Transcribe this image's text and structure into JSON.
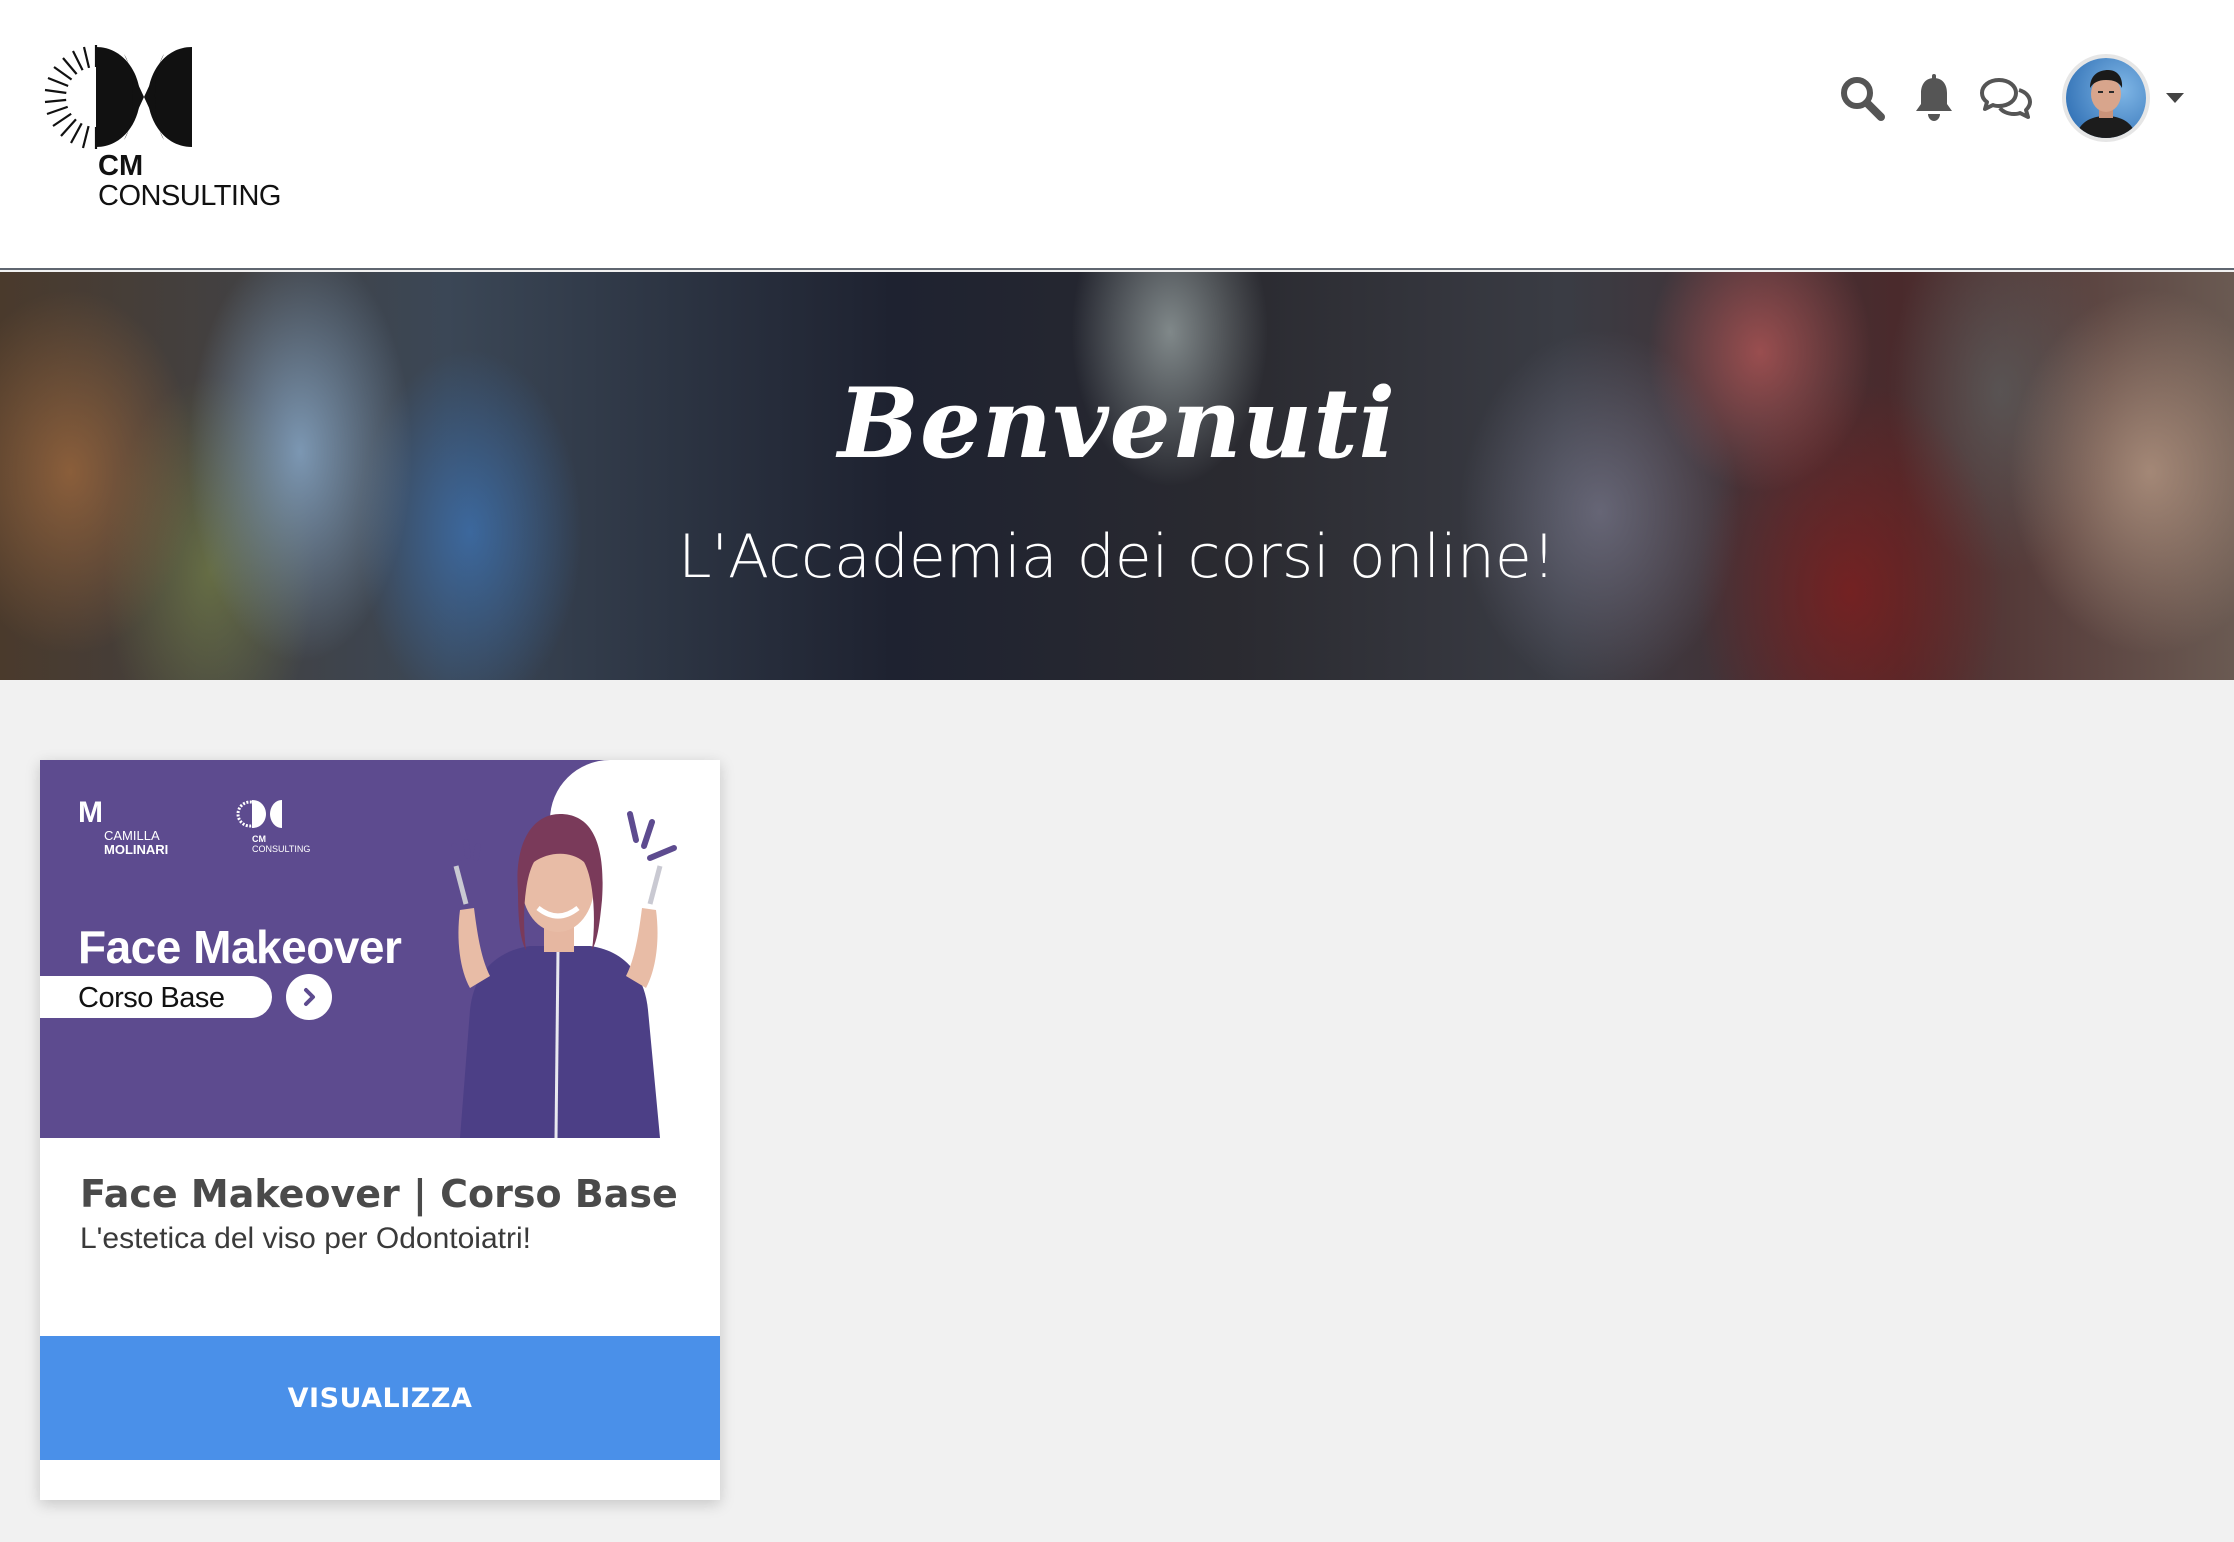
{
  "brand": {
    "line1": "CM",
    "line2": "CONSULTING"
  },
  "header": {
    "icons": [
      "search-icon",
      "bell-icon",
      "chat-icon"
    ],
    "avatar": "user-avatar"
  },
  "hero": {
    "title": "Benvenuti",
    "subtitle": "L'Accademia dei corsi online!"
  },
  "course": {
    "image": {
      "brand_letter": "M",
      "brand_name1": "CAMILLA",
      "brand_name2": "MOLINARI",
      "brand2_line1": "CM",
      "brand2_line2": "CONSULTING",
      "headline": "Face Makeover",
      "pill": "Corso Base"
    },
    "title": "Face Makeover | Corso Base",
    "description": "L'estetica del viso per Odontoiatri!",
    "button": "VISUALIZZA"
  },
  "colors": {
    "accent": "#4a90e9",
    "course_banner": "#5d4b8f",
    "page_bg": "#f1f1f1"
  }
}
